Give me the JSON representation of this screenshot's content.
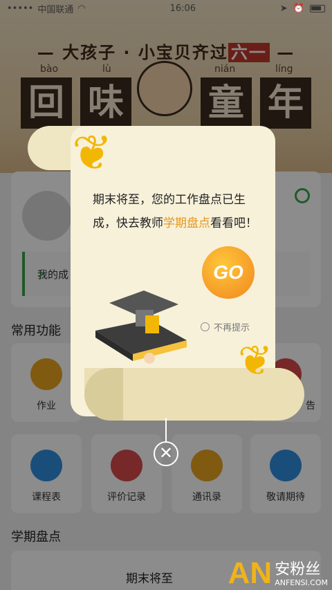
{
  "status_bar": {
    "carrier": "中国联通",
    "time": "16:06"
  },
  "banner": {
    "slogan_part1": "— 大孩子 · 小宝贝齐过",
    "slogan_highlight": "六一",
    "slogan_end": " —",
    "pinyin": [
      "bào",
      "lù",
      "nián",
      "líng"
    ],
    "chars": [
      "回",
      "味",
      "童",
      "年"
    ]
  },
  "profile": {
    "achievement_label": "我的成"
  },
  "sections": {
    "common_title": "常用功能",
    "semester_title": "学期盘点"
  },
  "common_functions": [
    {
      "label": "作业",
      "color": "#e9a51f"
    },
    {
      "label": "告",
      "color": "#d94a4a"
    }
  ],
  "grid": [
    {
      "label": "课程表",
      "color": "#2f8fe0",
      "icon": "calendar-icon"
    },
    {
      "label": "评价记录",
      "color": "#d94a4a",
      "icon": "star-icon"
    },
    {
      "label": "通讯录",
      "color": "#e9a51f",
      "icon": "contacts-icon"
    },
    {
      "label": "敬请期待",
      "color": "#2f8fe0",
      "icon": "hourglass-icon"
    }
  ],
  "bottom_card": {
    "text": "期末将至"
  },
  "popup": {
    "message_prefix": "期末将至，您的工作盘点已生成，快去教师",
    "message_highlight": "学期盘点",
    "message_suffix": "看看吧！",
    "go_label": "GO",
    "no_remind_label": "不再提示",
    "close_symbol": "✕"
  },
  "watermark": {
    "logo": "AN",
    "name": "安粉丝",
    "domain": "ANFENSI.COM"
  }
}
